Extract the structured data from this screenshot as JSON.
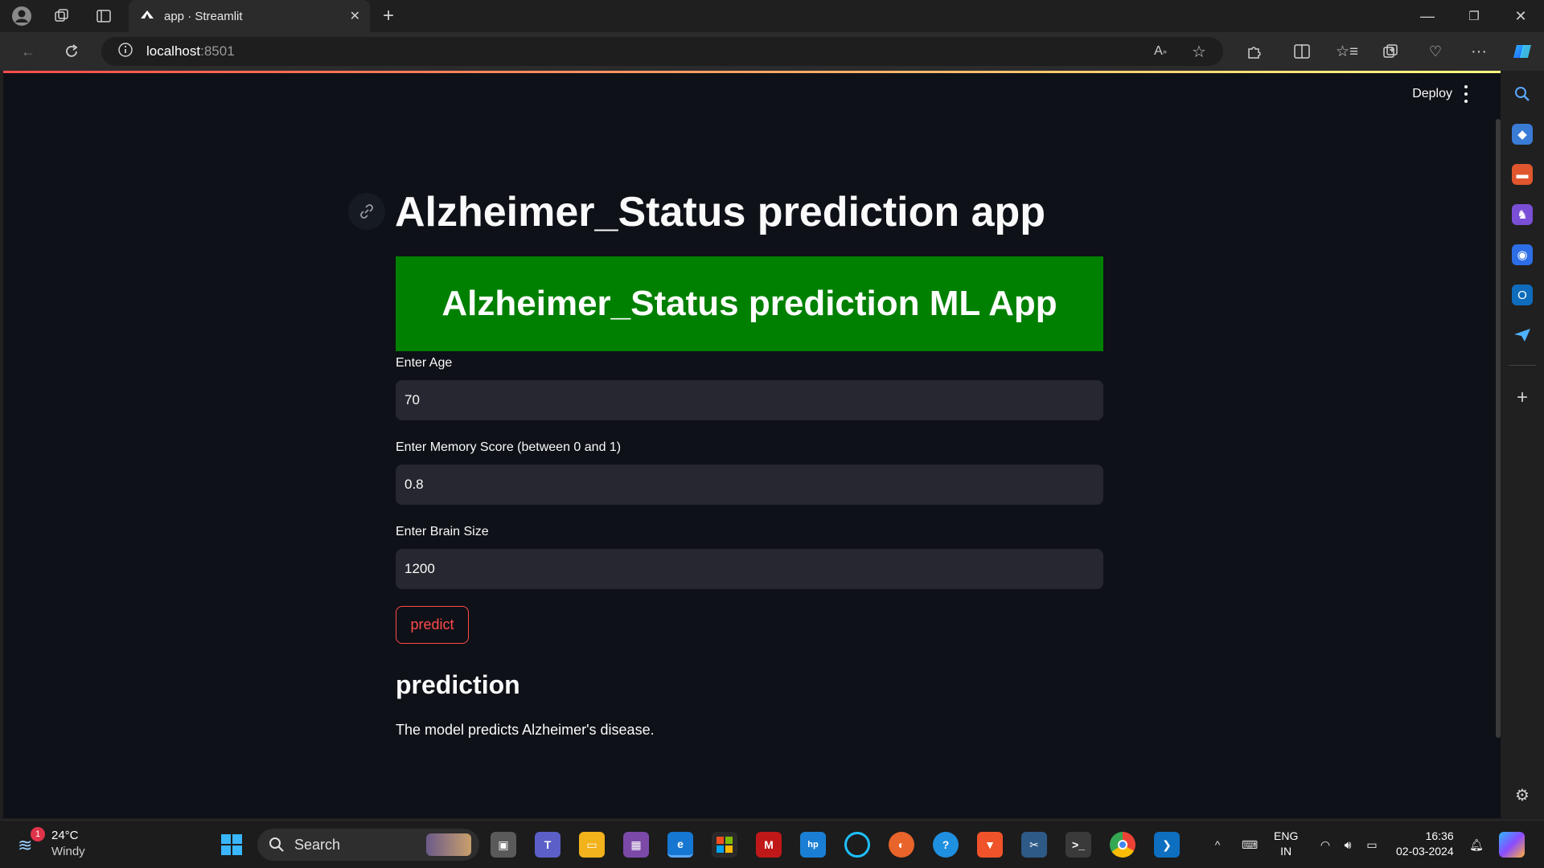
{
  "browser": {
    "tab_title": "app · Streamlit",
    "url_host": "localhost",
    "url_port": ":8501"
  },
  "app": {
    "deploy_label": "Deploy",
    "title": "Alzheimer_Status prediction app",
    "banner": "Alzheimer_Status prediction ML App",
    "fields": [
      {
        "label": "Enter Age",
        "value": "70"
      },
      {
        "label": "Enter Memory Score (between 0 and 1)",
        "value": "0.8"
      },
      {
        "label": "Enter Brain Size",
        "value": "1200"
      }
    ],
    "predict_label": "predict",
    "prediction_heading": "prediction",
    "prediction_result": "The model predicts Alzheimer's disease."
  },
  "taskbar": {
    "weather_temp": "24°C",
    "weather_desc": "Windy",
    "weather_badge": "1",
    "search_label": "Search",
    "lang_top": "ENG",
    "lang_bottom": "IN",
    "time": "16:36",
    "date": "02-03-2024"
  },
  "colors": {
    "app_bg": "#0e1117",
    "banner_bg": "#008000",
    "accent": "#ff4b4b",
    "input_bg": "#262730"
  }
}
